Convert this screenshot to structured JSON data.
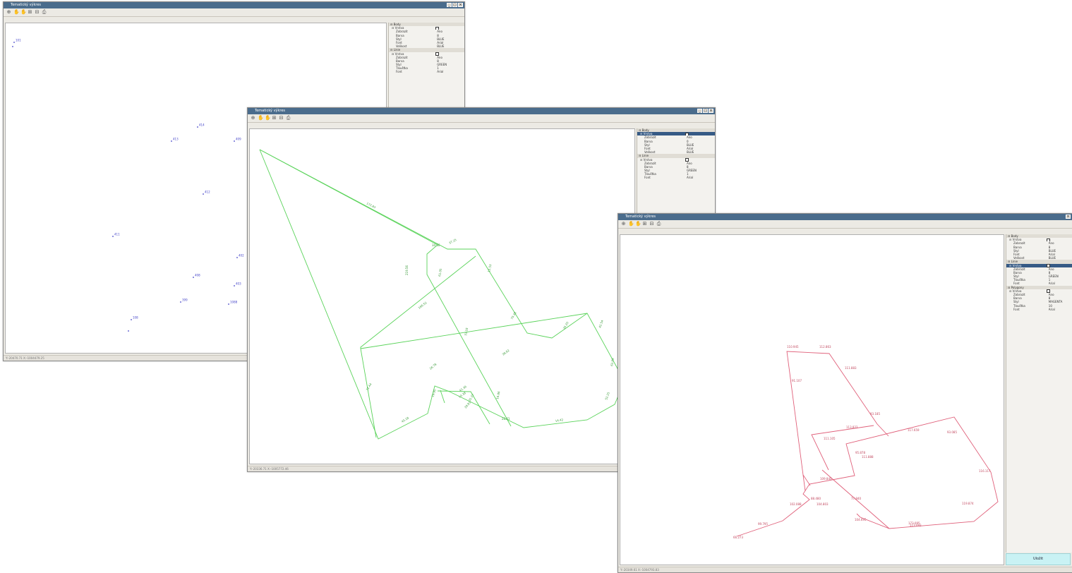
{
  "windows": [
    {
      "title": "Tematický výkres",
      "status": "Y:-20470.71   X:-1004479.25",
      "panel": [
        {
          "t": "section",
          "label": "Body"
        },
        {
          "t": "sub",
          "label": "Vrstva"
        },
        {
          "t": "prop",
          "label": "Zobrazit",
          "value": "Ano"
        },
        {
          "t": "prop",
          "label": "Barva",
          "value": "8"
        },
        {
          "t": "prop",
          "label": "Styl",
          "value": "BLUE"
        },
        {
          "t": "prop",
          "label": "Font",
          "value": "Arial"
        },
        {
          "t": "prop",
          "label": "Velikost",
          "value": "BLUE"
        },
        {
          "t": "section",
          "label": "Linie"
        },
        {
          "t": "sub",
          "label": "Vrstva"
        },
        {
          "t": "prop",
          "label": "Zobrazit",
          "value": "Ano"
        },
        {
          "t": "prop",
          "label": "Barva",
          "value": "8"
        },
        {
          "t": "prop",
          "label": "Styl",
          "value": "GREEN"
        },
        {
          "t": "prop",
          "label": "Tloušťka",
          "value": "1"
        },
        {
          "t": "prop",
          "label": "Font",
          "value": "Arial"
        }
      ],
      "point_labels": [
        "101",
        "413",
        "414",
        "409",
        "412",
        "411",
        "402",
        "408",
        "403",
        "399",
        "1088",
        "108"
      ]
    },
    {
      "title": "Tematický výkres",
      "status": "Y:-20336.71   X:-1005772.46",
      "panel": [
        {
          "t": "section",
          "label": "Body"
        },
        {
          "t": "sub",
          "label": "Vrstva",
          "sel": true
        },
        {
          "t": "prop",
          "label": "Zobrazit",
          "value": "Ano"
        },
        {
          "t": "prop",
          "label": "Barva",
          "value": "0"
        },
        {
          "t": "prop",
          "label": "Styl",
          "value": "BLUE"
        },
        {
          "t": "prop",
          "label": "Font",
          "value": "Arial"
        },
        {
          "t": "prop",
          "label": "Velikost",
          "value": "BLUE"
        },
        {
          "t": "section",
          "label": "Linie"
        },
        {
          "t": "sub",
          "label": "Vrstva"
        },
        {
          "t": "prop",
          "label": "Zobrazit",
          "value": "Ano"
        },
        {
          "t": "prop",
          "label": "Barva",
          "value": "8"
        },
        {
          "t": "prop",
          "label": "Styl",
          "value": "GREEN"
        },
        {
          "t": "prop",
          "label": "Tloušťka",
          "value": "1"
        },
        {
          "t": "prop",
          "label": "Font",
          "value": "Arial"
        }
      ],
      "segment_labels": [
        "172.83",
        "219.56",
        "34.56",
        "37.25",
        "61.05",
        "12.53",
        "166.52",
        "33.18",
        "70.38",
        "35.20",
        "42.54",
        "62.09",
        "38.82",
        "72.44",
        "45.18",
        "19.95",
        "26.78",
        "41.36",
        "28.81",
        "16.86",
        "22.61",
        "14.42",
        "52.25",
        "14.38",
        "31.27"
      ]
    },
    {
      "title": "Tematický výkres",
      "status": "Y:-20349.61   X:-1004793.83",
      "save_label": "Uložit",
      "panel": [
        {
          "t": "section",
          "label": "Body"
        },
        {
          "t": "sub",
          "label": "Vrstva"
        },
        {
          "t": "prop",
          "label": "Zobrazit",
          "value": "Ano"
        },
        {
          "t": "prop",
          "label": "Barva",
          "value": "8"
        },
        {
          "t": "prop",
          "label": "Styl",
          "value": "BLUE"
        },
        {
          "t": "prop",
          "label": "Font",
          "value": "Arial"
        },
        {
          "t": "prop",
          "label": "Velikost",
          "value": "BLUE"
        },
        {
          "t": "section",
          "label": "Linie"
        },
        {
          "t": "sub",
          "label": "Vrstva",
          "sel": true
        },
        {
          "t": "prop",
          "label": "Zobrazit",
          "value": "Ano"
        },
        {
          "t": "prop",
          "label": "Barva",
          "value": "8"
        },
        {
          "t": "prop",
          "label": "Styl",
          "value": "GREEN"
        },
        {
          "t": "prop",
          "label": "Tloušťka",
          "value": "1"
        },
        {
          "t": "prop",
          "label": "Font",
          "value": "Arial"
        },
        {
          "t": "section",
          "label": "Polygony"
        },
        {
          "t": "sub",
          "label": "Vrstva"
        },
        {
          "t": "prop",
          "label": "Zobrazit",
          "value": "Ano"
        },
        {
          "t": "prop",
          "label": "Barva",
          "value": "8"
        },
        {
          "t": "prop",
          "label": "Styl",
          "value": "MAGENTA"
        },
        {
          "t": "prop",
          "label": "Tloušťka",
          "value": "10"
        },
        {
          "t": "prop",
          "label": "Font",
          "value": "Arial"
        }
      ],
      "segment_labels": [
        "66.273",
        "99.795",
        "102.088",
        "88.480",
        "77.840",
        "104.695",
        "173.095",
        "119.874",
        "116.117",
        "93.085",
        "117.659",
        "111.888",
        "109.845",
        "104.803",
        "110.945",
        "112.863",
        "111.883",
        "93.185",
        "111.105",
        "91.107",
        "113.822",
        "95.878",
        "113.093"
      ]
    }
  ],
  "colors": {
    "titlebar": "#4a6c8c",
    "points": "#4242c8",
    "lines": "#5ad35a",
    "polygons": "#e0607a",
    "selection": "#365a85",
    "save_button": "#c9f2f4"
  },
  "icons": [
    "zoom-icon",
    "pan-icon",
    "pan-alt-icon",
    "zoom-in-icon",
    "zoom-out-icon",
    "print-icon"
  ]
}
